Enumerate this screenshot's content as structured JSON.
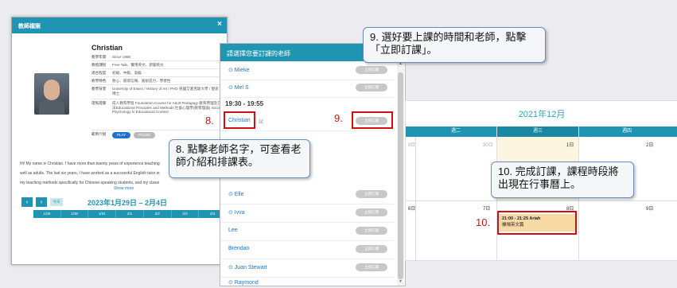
{
  "teacher_modal": {
    "title": "教師檔案",
    "close": "×",
    "name": "Christian",
    "info": [
      {
        "key": "教學年資",
        "value": "Since 1998"
      },
      {
        "key": "教授課程",
        "value": "Free Talk、實用英文、新聞英文"
      },
      {
        "key": "適合程度",
        "value": "初級、中級、高級"
      },
      {
        "key": "教學特色",
        "value": "耐心、值得信賴、富創造力、學者性"
      },
      {
        "key": "教學背景",
        "value": "University of Essex / History of Art / PHD 英國艾塞克斯大學 / 歷史 / 博士"
      },
      {
        "key": "證照證書",
        "value": "成人教育學程 Foundation Course for Adult Pedagogy 教育原理及方法Educational Principles and Methods 社會心理學(教育理論) Social Psychology in Educational Context"
      },
      {
        "key": "範例介紹",
        "value": ""
      }
    ],
    "play": "PLAY",
    "pause": "PAUSE",
    "bio": [
      "Hi! My name is Christian. I have more than twenty years of experience teaching",
      "well as adults. The last six years, I have worked as a successful English tutor in",
      "my teaching methods specifically for Chinese-speaking students, and my classi"
    ],
    "show_more": "Show more",
    "today": "今天",
    "date_range": "2023年1月29日 – 2月4日",
    "days": [
      "1/29",
      "1/30",
      "1/31",
      "2/1",
      "2/2",
      "2/3",
      "2/4"
    ]
  },
  "teacher_list": {
    "title": "請選擇您要訂課的老師",
    "time_slot": "19:30 - 19:55",
    "book_label": "立即訂課",
    "christian_badge": "試",
    "rows_before": [
      "⊙ Mieke",
      "⊙ Mel S"
    ],
    "christian": "Christian",
    "rows_after": [
      "⊙ Elle",
      "⊙ Ivva",
      "Lee",
      "Brendan",
      "⊙ Juan Stewart",
      "⊙ Raymond"
    ]
  },
  "calendar": {
    "title": "2021年12月",
    "headers": [
      "週二",
      "週三",
      "週四"
    ],
    "row1": [
      "30日",
      "1日",
      "2日"
    ],
    "row1_left": "9日",
    "row2": [
      "7日",
      "8日",
      "9日"
    ],
    "row2_left": "6日",
    "event_time": "21:00 - 21:25 Ariah",
    "event_course": "機場英文篇"
  },
  "callouts": {
    "c8": "8. 點擊老師名字，可查看老師介紹和排課表。",
    "c9": "9. 選好要上課的時間和老師，點擊「立即訂課」。",
    "c10": "10. 完成訂課，課程時段將出現在行事曆上。",
    "mark8": "8.",
    "mark9": "9.",
    "mark10": "10."
  }
}
